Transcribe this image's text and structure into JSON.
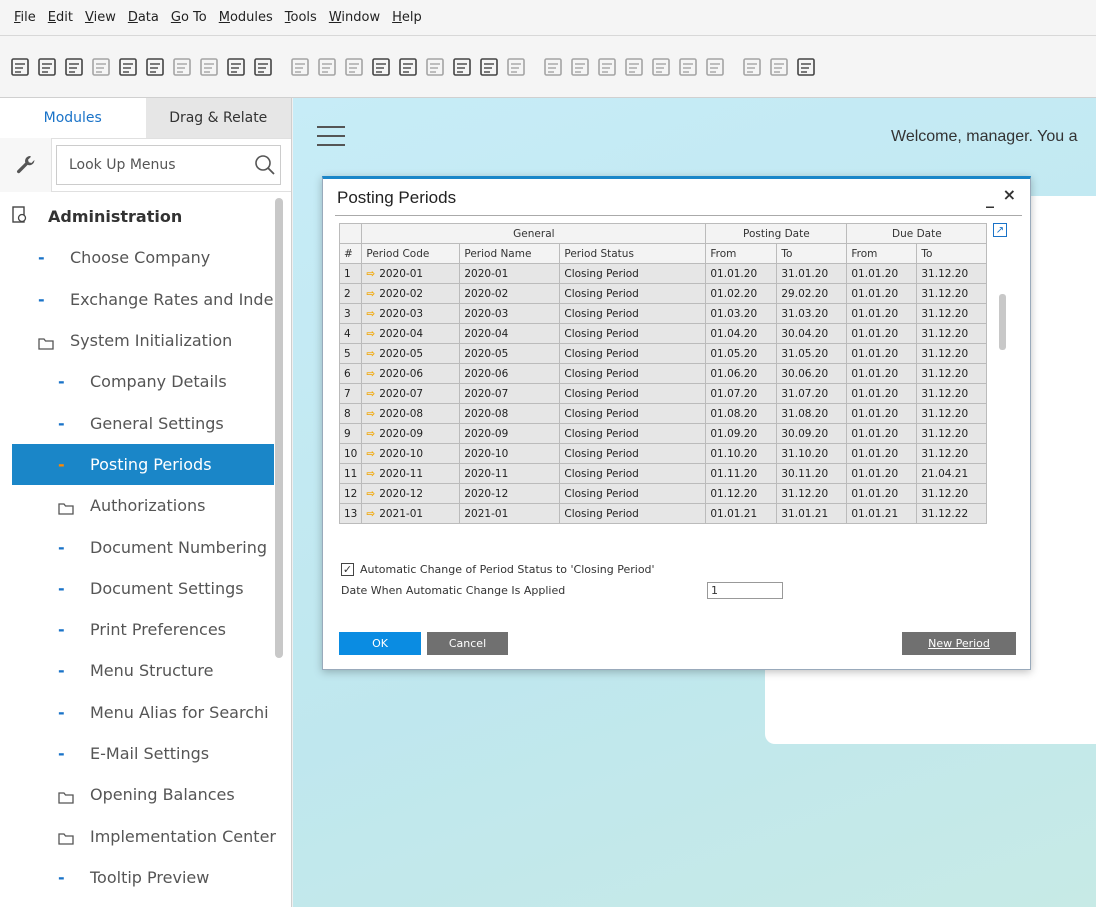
{
  "menubar": {
    "items": [
      {
        "pre": "",
        "u": "F",
        "post": "ile"
      },
      {
        "pre": "",
        "u": "E",
        "post": "dit"
      },
      {
        "pre": "",
        "u": "V",
        "post": "iew"
      },
      {
        "pre": "",
        "u": "D",
        "post": "ata"
      },
      {
        "pre": "",
        "u": "G",
        "post": "o To"
      },
      {
        "pre": "",
        "u": "M",
        "post": "odules"
      },
      {
        "pre": "",
        "u": "T",
        "post": "ools"
      },
      {
        "pre": "",
        "u": "W",
        "post": "indow"
      },
      {
        "pre": "",
        "u": "H",
        "post": "elp"
      }
    ]
  },
  "sidebar": {
    "tabs": {
      "modules": "Modules",
      "drag_relate": "Drag & Relate"
    },
    "lookup_text": "Look Up Menus",
    "items": [
      {
        "label": "Administration",
        "level": 0,
        "kind": "root"
      },
      {
        "label": "Choose Company",
        "level": 1,
        "kind": "leaf"
      },
      {
        "label": "Exchange Rates and Inde",
        "level": 1,
        "kind": "leaf"
      },
      {
        "label": "System Initialization",
        "level": 1,
        "kind": "folder"
      },
      {
        "label": "Company Details",
        "level": 2,
        "kind": "leaf"
      },
      {
        "label": "General Settings",
        "level": 2,
        "kind": "leaf"
      },
      {
        "label": "Posting Periods",
        "level": 2,
        "kind": "leaf",
        "selected": true
      },
      {
        "label": "Authorizations",
        "level": 2,
        "kind": "folder"
      },
      {
        "label": "Document Numbering",
        "level": 2,
        "kind": "leaf"
      },
      {
        "label": "Document Settings",
        "level": 2,
        "kind": "leaf"
      },
      {
        "label": "Print Preferences",
        "level": 2,
        "kind": "leaf"
      },
      {
        "label": "Menu Structure",
        "level": 2,
        "kind": "leaf"
      },
      {
        "label": "Menu Alias for Searchi",
        "level": 2,
        "kind": "leaf"
      },
      {
        "label": "E-Mail Settings",
        "level": 2,
        "kind": "leaf"
      },
      {
        "label": "Opening Balances",
        "level": 2,
        "kind": "folder"
      },
      {
        "label": "Implementation Center",
        "level": 2,
        "kind": "folder"
      },
      {
        "label": "Tooltip Preview",
        "level": 2,
        "kind": "leaf"
      }
    ]
  },
  "main": {
    "welcome": "Welcome, manager. You a"
  },
  "dialog": {
    "title": "Posting Periods",
    "minimize": "_",
    "close": "×",
    "groups": {
      "general": "General",
      "posting_date": "Posting Date",
      "due_date": "Due Date"
    },
    "columns": [
      "#",
      "Period Code",
      "Period Name",
      "Period Status",
      "From",
      "To",
      "From",
      "To"
    ],
    "rows": [
      [
        "1",
        "2020-01",
        "2020-01",
        "Closing Period",
        "01.01.20",
        "31.01.20",
        "01.01.20",
        "31.12.20"
      ],
      [
        "2",
        "2020-02",
        "2020-02",
        "Closing Period",
        "01.02.20",
        "29.02.20",
        "01.01.20",
        "31.12.20"
      ],
      [
        "3",
        "2020-03",
        "2020-03",
        "Closing Period",
        "01.03.20",
        "31.03.20",
        "01.01.20",
        "31.12.20"
      ],
      [
        "4",
        "2020-04",
        "2020-04",
        "Closing Period",
        "01.04.20",
        "30.04.20",
        "01.01.20",
        "31.12.20"
      ],
      [
        "5",
        "2020-05",
        "2020-05",
        "Closing Period",
        "01.05.20",
        "31.05.20",
        "01.01.20",
        "31.12.20"
      ],
      [
        "6",
        "2020-06",
        "2020-06",
        "Closing Period",
        "01.06.20",
        "30.06.20",
        "01.01.20",
        "31.12.20"
      ],
      [
        "7",
        "2020-07",
        "2020-07",
        "Closing Period",
        "01.07.20",
        "31.07.20",
        "01.01.20",
        "31.12.20"
      ],
      [
        "8",
        "2020-08",
        "2020-08",
        "Closing Period",
        "01.08.20",
        "31.08.20",
        "01.01.20",
        "31.12.20"
      ],
      [
        "9",
        "2020-09",
        "2020-09",
        "Closing Period",
        "01.09.20",
        "30.09.20",
        "01.01.20",
        "31.12.20"
      ],
      [
        "10",
        "2020-10",
        "2020-10",
        "Closing Period",
        "01.10.20",
        "31.10.20",
        "01.01.20",
        "31.12.20"
      ],
      [
        "11",
        "2020-11",
        "2020-11",
        "Closing Period",
        "01.11.20",
        "30.11.20",
        "01.01.20",
        "21.04.21"
      ],
      [
        "12",
        "2020-12",
        "2020-12",
        "Closing Period",
        "01.12.20",
        "31.12.20",
        "01.01.20",
        "31.12.20"
      ],
      [
        "13",
        "2021-01",
        "2021-01",
        "Closing Period",
        "01.01.21",
        "31.01.21",
        "01.01.21",
        "31.12.22"
      ]
    ],
    "auto_change_label": "Automatic Change of Period Status to 'Closing Period'",
    "auto_change_checked": true,
    "date_label": "Date When Automatic Change Is Applied",
    "date_value": "1",
    "ok_label": "OK",
    "cancel_label": "Cancel",
    "new_period_label": "New Period"
  },
  "colors": {
    "accent": "#1a86c8",
    "ok_button": "#0a8ce2",
    "grey_button": "#707070",
    "arrow": "#f2a600"
  }
}
